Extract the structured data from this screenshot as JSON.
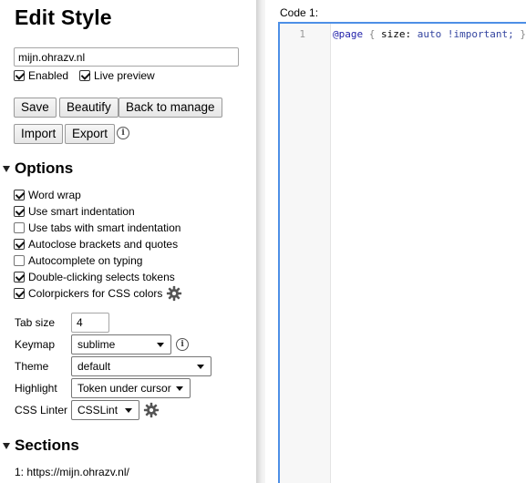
{
  "title": "Edit Style",
  "name_field": {
    "value": "mijn.ohrazv.nl"
  },
  "toggles": [
    {
      "label": "Enabled",
      "checked": true
    },
    {
      "label": "Live preview",
      "checked": true
    }
  ],
  "buttons": {
    "save": "Save",
    "beautify": "Beautify",
    "back": "Back to manage",
    "import": "Import",
    "export": "Export"
  },
  "options": {
    "heading": "Options",
    "items": [
      {
        "label": "Word wrap",
        "checked": true
      },
      {
        "label": "Use smart indentation",
        "checked": true
      },
      {
        "label": "Use tabs with smart indentation",
        "checked": false
      },
      {
        "label": "Autoclose brackets and quotes",
        "checked": true
      },
      {
        "label": "Autocomplete on typing",
        "checked": false
      },
      {
        "label": "Double-clicking selects tokens",
        "checked": true
      },
      {
        "label": "Colorpickers for CSS colors",
        "checked": true
      }
    ],
    "tab_size": {
      "label": "Tab size",
      "value": "4"
    },
    "keymap": {
      "label": "Keymap",
      "value": "sublime"
    },
    "theme": {
      "label": "Theme",
      "value": "default"
    },
    "highlight": {
      "label": "Highlight",
      "value": "Token under cursor"
    },
    "linter": {
      "label": "CSS Linter",
      "value": "CSSLint"
    }
  },
  "sections": {
    "heading": "Sections",
    "items": [
      "1: https://mijn.ohrazv.nl/"
    ]
  },
  "editor": {
    "label": "Code 1:",
    "line_number": "1",
    "code_tokens": {
      "at_rule": "@page",
      "open_brace": "{",
      "property": "size:",
      "value": "auto",
      "important": "!important;",
      "close_brace": "}"
    }
  },
  "colors": {
    "editor_focus_border": "#4d8fe6",
    "at_rule": "#2222aa",
    "value": "#3445a0"
  }
}
